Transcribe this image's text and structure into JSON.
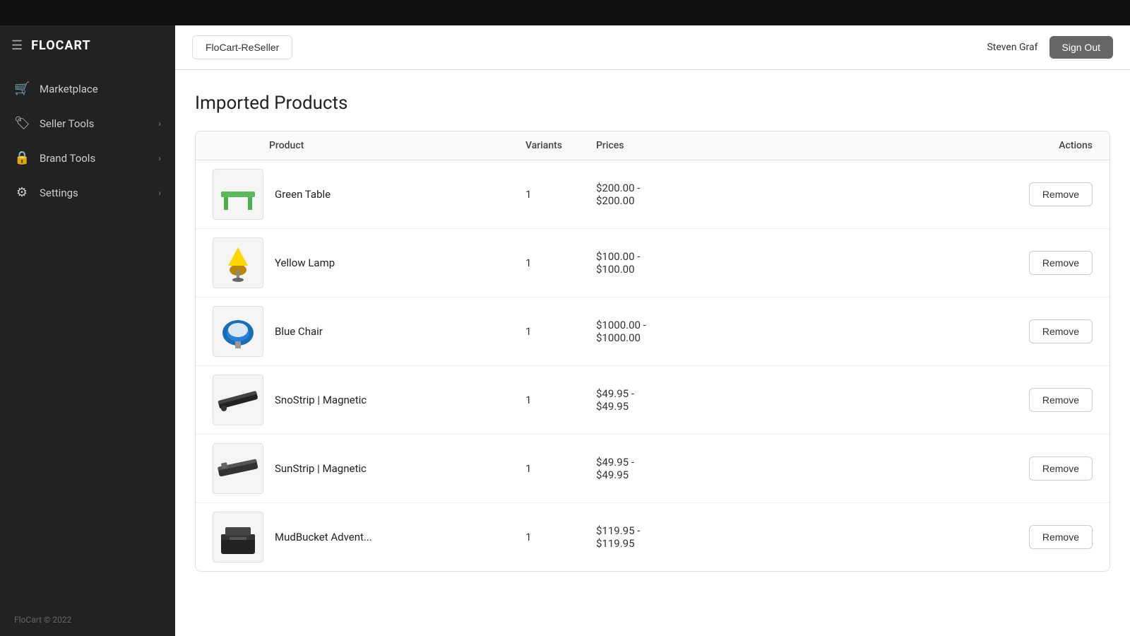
{
  "topbar": {},
  "sidebar": {
    "logo": "FLOCART",
    "items": [
      {
        "id": "marketplace",
        "label": "Marketplace",
        "icon": "🛒",
        "hasChevron": false
      },
      {
        "id": "seller-tools",
        "label": "Seller Tools",
        "icon": "🏷",
        "hasChevron": true
      },
      {
        "id": "brand-tools",
        "label": "Brand Tools",
        "icon": "🔒",
        "hasChevron": true
      },
      {
        "id": "settings",
        "label": "Settings",
        "icon": "⚙",
        "hasChevron": true
      }
    ],
    "footer": "FloCart © 2022"
  },
  "header": {
    "store_tab": "FloCart-ReSeller",
    "user_name": "Steven Graf",
    "sign_out_label": "Sign Out"
  },
  "page": {
    "title": "Imported Products",
    "table": {
      "columns": [
        "",
        "Product",
        "Variants",
        "Prices",
        "",
        "Actions"
      ],
      "rows": [
        {
          "id": 1,
          "name": "Green Table",
          "variants": "1",
          "price": "$200.00 -\n$200.00",
          "thumb_type": "green-table"
        },
        {
          "id": 2,
          "name": "Yellow Lamp",
          "variants": "1",
          "price": "$100.00 -\n$100.00",
          "thumb_type": "yellow-lamp"
        },
        {
          "id": 3,
          "name": "Blue Chair",
          "variants": "1",
          "price": "$1000.00 -\n$1000.00",
          "thumb_type": "blue-chair"
        },
        {
          "id": 4,
          "name": "SnoStrip | Magnetic",
          "variants": "1",
          "price": "$49.95 -\n$49.95",
          "thumb_type": "snostrip"
        },
        {
          "id": 5,
          "name": "SunStrip | Magnetic",
          "variants": "1",
          "price": "$49.95 -\n$49.95",
          "thumb_type": "sunstrip"
        },
        {
          "id": 6,
          "name": "MudBucket Advent...",
          "variants": "1",
          "price": "$119.95 -\n$119.95",
          "thumb_type": "mudbucket"
        }
      ],
      "remove_label": "Remove"
    }
  }
}
